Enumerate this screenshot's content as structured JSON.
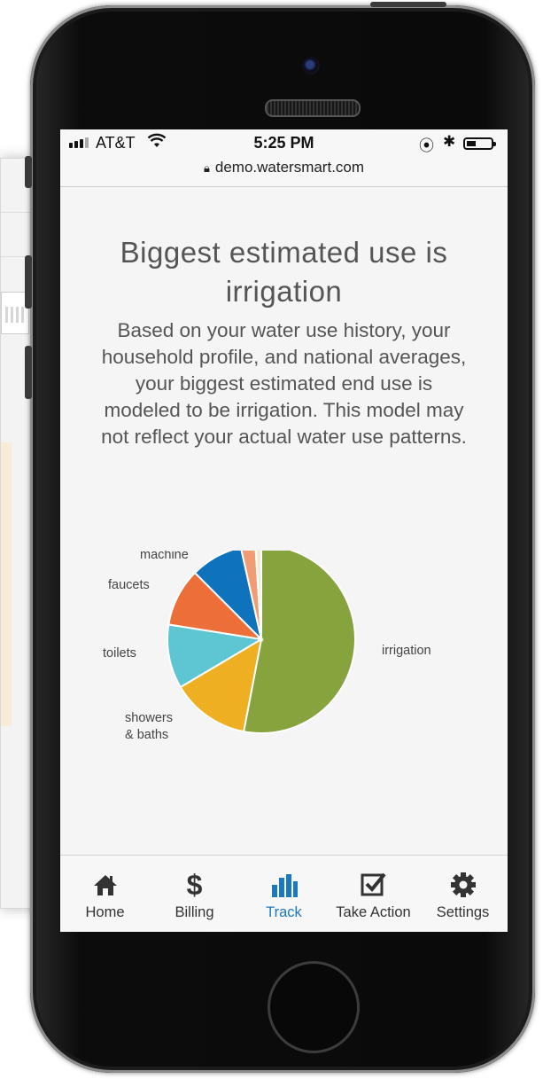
{
  "status_bar": {
    "carrier": "AT&T",
    "time": "5:25 PM",
    "url": "demo.watersmart.com"
  },
  "page": {
    "title": "Biggest estimated use is irrigation",
    "description": "Based on your water use history, your household profile, and national averages, your biggest estimated end use is modeled to be irrigation. This model may not reflect your actual water use patterns."
  },
  "chart_data": {
    "type": "pie",
    "slices": [
      {
        "label": "irrigation",
        "value": 53,
        "color": "#86a33e"
      },
      {
        "label": "showers & baths",
        "value": 13.5,
        "color": "#eeb022"
      },
      {
        "label": "toilets",
        "value": 11,
        "color": "#5ec6d3"
      },
      {
        "label": "faucets",
        "value": 10,
        "color": "#ec6e38"
      },
      {
        "label": "washing machine",
        "value": 9,
        "color": "#0e72bd"
      },
      {
        "label": "",
        "value": 2.5,
        "color": "#f29c75"
      },
      {
        "label": "",
        "value": 1,
        "color": "#f1ebd6"
      }
    ]
  },
  "tab_bar": {
    "tabs": [
      {
        "label": "Home",
        "icon": "home-icon"
      },
      {
        "label": "Billing",
        "icon": "dollar-icon"
      },
      {
        "label": "Track",
        "icon": "bar-chart-icon",
        "active": true
      },
      {
        "label": "Take Action",
        "icon": "checkbox-icon"
      },
      {
        "label": "Settings",
        "icon": "gear-icon"
      }
    ],
    "active_color": "#1a78c2"
  }
}
